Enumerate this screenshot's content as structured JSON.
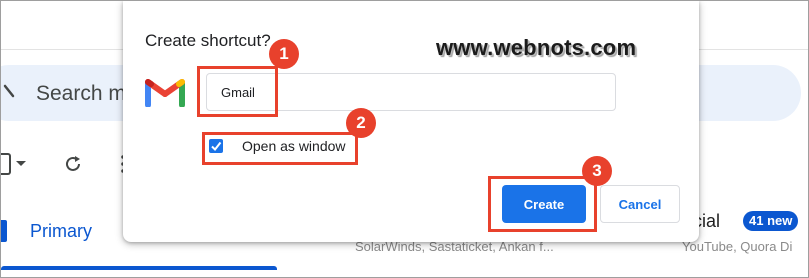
{
  "background": {
    "search_placeholder": "Search m",
    "tabs": [
      {
        "label": "Primary",
        "snippet": "SolarWinds, Sastaticket, Ankan f..."
      },
      {
        "label": "ocial",
        "badge": "41 new",
        "snippet": "YouTube, Quora Di"
      }
    ],
    "accent_color": "#0b57d0"
  },
  "dialog": {
    "title": "Create shortcut?",
    "logo": "gmail-m-logo",
    "name_value": "Gmail",
    "open_as_window_label": "Open as window",
    "open_as_window_checked": true,
    "create_label": "Create",
    "cancel_label": "Cancel",
    "primary_color": "#1a73e8"
  },
  "annotations": {
    "markers": [
      "1",
      "2",
      "3"
    ],
    "highlight_color": "#e8412c",
    "watermark": "www.webnots.com"
  }
}
